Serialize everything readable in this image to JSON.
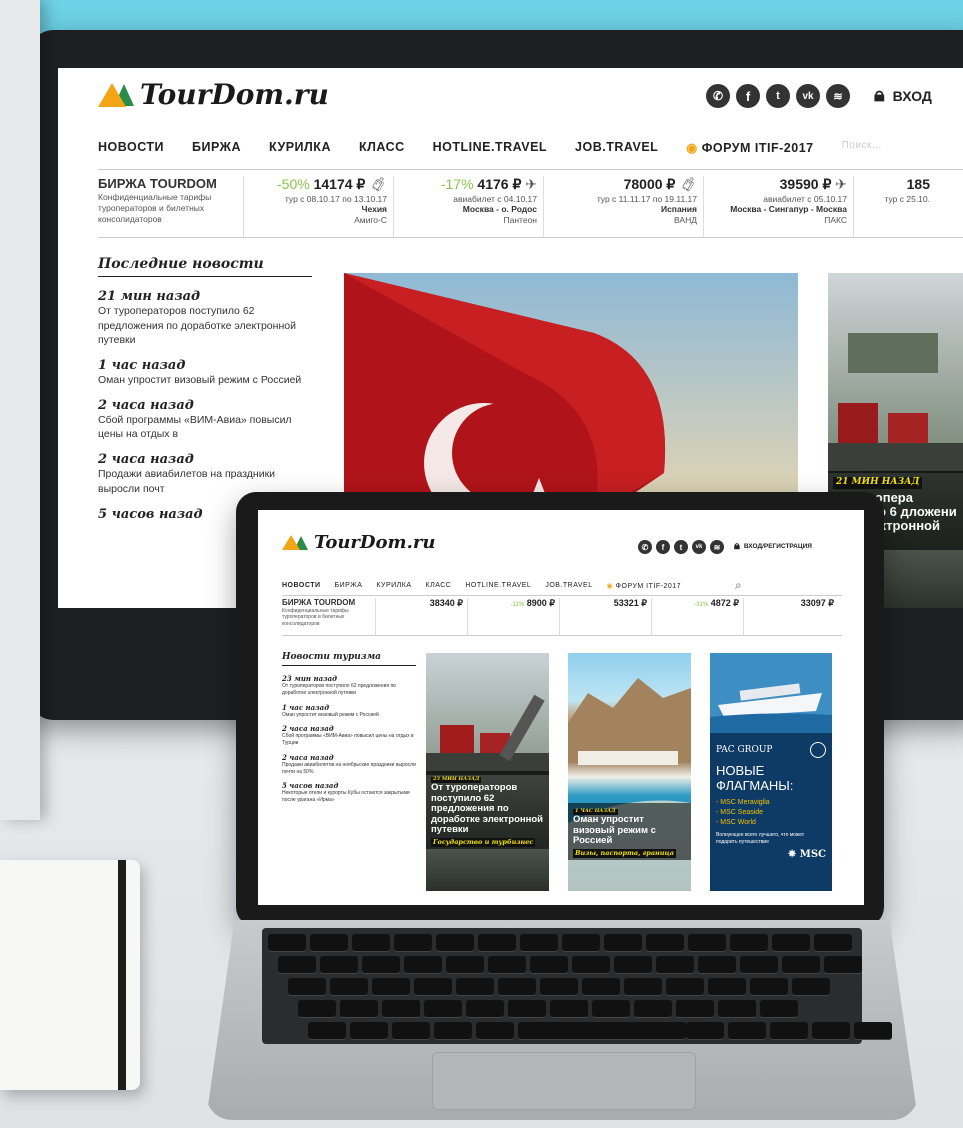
{
  "brand": {
    "logo": "TourDom.ru",
    "login_monitor": "вход",
    "login_laptop": "ВХОД/РЕГИСТРАЦИЯ",
    "search_placeholder": "Поиск..."
  },
  "social_icons": [
    "phone-icon",
    "facebook-icon",
    "twitter-icon",
    "vk-icon",
    "rss-icon"
  ],
  "nav_monitor": [
    "НОВОСТИ",
    "БИРЖА",
    "КУРИЛКА",
    "КЛАСС",
    "HOTLINE.TRAVEL",
    "JOB.TRAVEL",
    "ФОРУМ ITIF-2017"
  ],
  "nav_laptop": [
    "НОВОСТИ",
    "БИРЖА",
    "КУРИЛКА",
    "КЛАСС",
    "HOTLINE.TRAVEL",
    "JOB.TRAVEL",
    "ФОРУМ ITIF-2017"
  ],
  "birzha": {
    "title": "БИРЖА TOURDOM",
    "desc": "Конфиденциальные тарифы туроператоров и билетных консолидаторов"
  },
  "offers_monitor": [
    {
      "pct": "-50%",
      "price": "14174 ₽",
      "line": "тур с 08.10.17 по 13.10.17",
      "dest": "Чехия",
      "op": "Амиго-С"
    },
    {
      "pct": "-17%",
      "price": "4176 ₽",
      "line": "авиабилет с 04.10.17",
      "dest": "Москва - о. Родос",
      "op": "Пантеон"
    },
    {
      "pct": "",
      "price": "78000 ₽",
      "line": "тур с 11.11.17 по 19.11.17",
      "dest": "Испания",
      "op": "ВАНД"
    },
    {
      "pct": "",
      "price": "39590 ₽",
      "line": "авиабилет с 05.10.17",
      "dest": "Москва - Сингапур - Москва",
      "op": "ПАКС"
    },
    {
      "pct": "",
      "price": "185",
      "line": "тур с 25.10.",
      "dest": "",
      "op": ""
    }
  ],
  "offers_laptop": [
    {
      "pct": "",
      "price": "38340 ₽"
    },
    {
      "pct": "-11%",
      "price": "8900 ₽"
    },
    {
      "pct": "",
      "price": "53321 ₽"
    },
    {
      "pct": "-31%",
      "price": "4872 ₽"
    },
    {
      "pct": "",
      "price": "33097 ₽"
    }
  ],
  "news_monitor": {
    "heading": "Последние новости",
    "items": [
      {
        "time": "21 мин назад",
        "text": "От туроператоров поступило 62 предложения по доработке электронной путевки"
      },
      {
        "time": "1 час назад",
        "text": "Оман упростит визовый режим с Россией"
      },
      {
        "time": "2 часа назад",
        "text": "Сбой программы «ВИМ-Авиа» повысил цены на отдых в"
      },
      {
        "time": "2 часа назад",
        "text": "Продажи авиабилетов на праздники выросли почт"
      },
      {
        "time": "5 часов назад",
        "text": ""
      }
    ]
  },
  "news_laptop": {
    "heading": "Новости туризма",
    "items": [
      {
        "time": "23 мин назад",
        "text": "От туроператоров поступило 62 предложения по доработке электронной путевки"
      },
      {
        "time": "1 час назад",
        "text": "Оман упростит визовый режим с Россией"
      },
      {
        "time": "2 часа назад",
        "text": "Сбой программы «ВИМ-Авиа» повысил цены на отдых в Турции"
      },
      {
        "time": "2 часа назад",
        "text": "Продажи авиабилетов на ноябрьские праздники выросли почти на 50%"
      },
      {
        "time": "5 часов назад",
        "text": "Некоторые отели и курорты Кубы остаются закрытыми после урагана «Ирма»"
      }
    ]
  },
  "monitor_side_story": {
    "tag": "21 МИН НАЗАД",
    "headline": "От турoпера ступило 6 дложени аботке ктронной евки"
  },
  "laptop_stories": [
    {
      "tag": "23 МИН НАЗАД",
      "headline": "От туроператоров поступило 62 предложения по доработке электронной путевки",
      "rubric": "Государство и турбизнес"
    },
    {
      "tag": "1 ЧАС НАЗАД",
      "headline": "Оман упростит визовый режим с Россией",
      "rubric": "Визы, паспорта, граница"
    }
  ],
  "ad": {
    "brand": "PAC GROUP",
    "headline": "НОВЫЕ ФЛАГМАНЫ:",
    "items": [
      "- MSC Meraviglia",
      "- MSC Seaside",
      "- MSC World"
    ],
    "sub": "Волнующее всего лучшего, что может подарить путешествие",
    "logo": "MSC"
  },
  "colors": {
    "accent_green": "#2a8c46",
    "accent_orange": "#f2a516",
    "discount": "#8bc34a",
    "tag_yellow": "#f3e100"
  }
}
